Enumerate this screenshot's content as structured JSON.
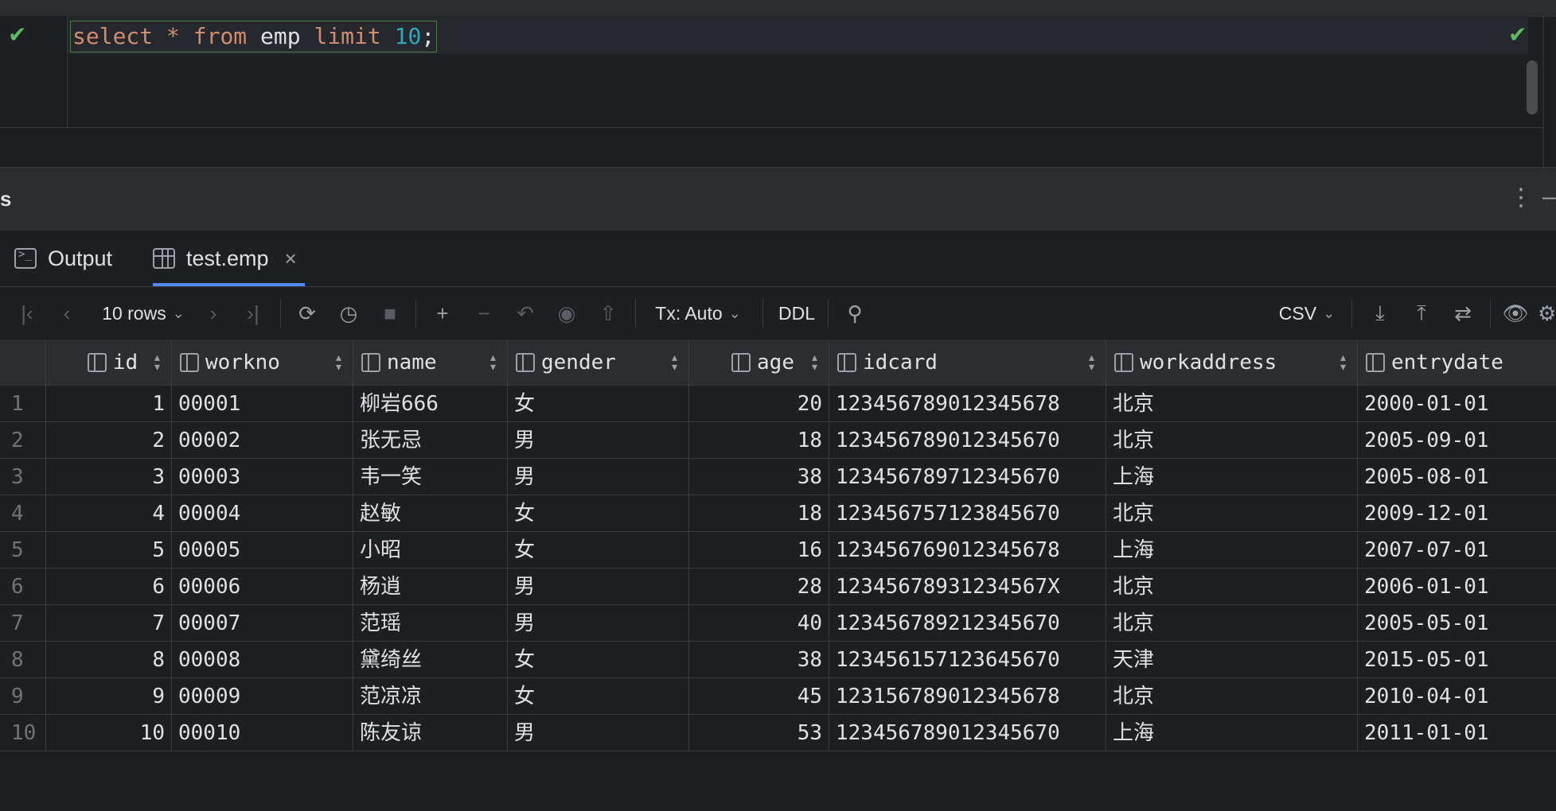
{
  "editor": {
    "sql": {
      "select": "select",
      "star": "*",
      "from": "from",
      "table": "emp",
      "limit": "limit",
      "num": "10",
      "semi": ";"
    }
  },
  "panel": {
    "title": "s"
  },
  "tabs": [
    {
      "label": "Output",
      "icon": "terminal-icon"
    },
    {
      "label": "test.emp",
      "icon": "table-icon"
    }
  ],
  "toolbar": {
    "rows": "10 rows",
    "tx": "Tx: Auto",
    "ddl": "DDL",
    "csv": "CSV"
  },
  "grid": {
    "columns": [
      "id",
      "workno",
      "name",
      "gender",
      "age",
      "idcard",
      "workaddress",
      "entrydate"
    ],
    "rows": [
      [
        "1",
        "1",
        "00001",
        "柳岩666",
        "女",
        "20",
        "123456789012345678",
        "北京",
        "2000-01-01"
      ],
      [
        "2",
        "2",
        "00002",
        "张无忌",
        "男",
        "18",
        "123456789012345670",
        "北京",
        "2005-09-01"
      ],
      [
        "3",
        "3",
        "00003",
        "韦一笑",
        "男",
        "38",
        "123456789712345670",
        "上海",
        "2005-08-01"
      ],
      [
        "4",
        "4",
        "00004",
        "赵敏",
        "女",
        "18",
        "123456757123845670",
        "北京",
        "2009-12-01"
      ],
      [
        "5",
        "5",
        "00005",
        "小昭",
        "女",
        "16",
        "123456769012345678",
        "上海",
        "2007-07-01"
      ],
      [
        "6",
        "6",
        "00006",
        "杨逍",
        "男",
        "28",
        "12345678931234567X",
        "北京",
        "2006-01-01"
      ],
      [
        "7",
        "7",
        "00007",
        "范瑶",
        "男",
        "40",
        "123456789212345670",
        "北京",
        "2005-05-01"
      ],
      [
        "8",
        "8",
        "00008",
        "黛绮丝",
        "女",
        "38",
        "123456157123645670",
        "天津",
        "2015-05-01"
      ],
      [
        "9",
        "9",
        "00009",
        "范凉凉",
        "女",
        "45",
        "123156789012345678",
        "北京",
        "2010-04-01"
      ],
      [
        "10",
        "10",
        "00010",
        "陈友谅",
        "男",
        "53",
        "123456789012345670",
        "上海",
        "2011-01-01"
      ]
    ]
  }
}
